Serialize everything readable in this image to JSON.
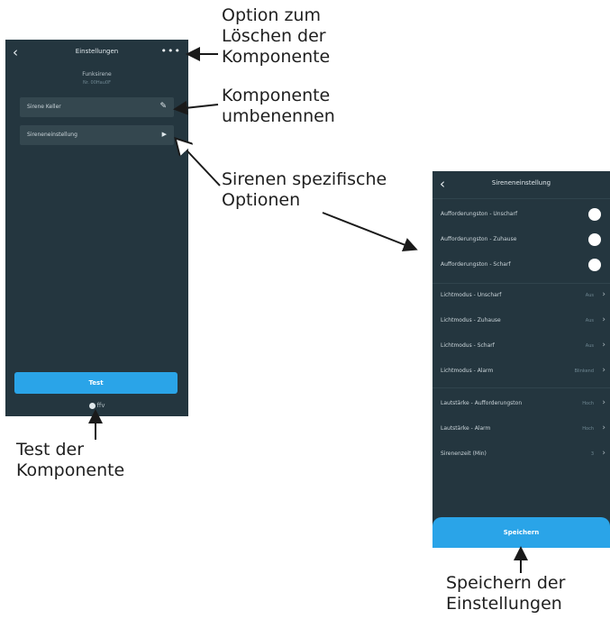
{
  "screen1": {
    "title": "Einstellungen",
    "device_type": "Funksirene",
    "device_status": "Nr. 00Hau0F",
    "rows": [
      {
        "label": "Sirene Keller",
        "icon": "edit-icon"
      },
      {
        "label": "Sireneneinstellung",
        "icon": "chevron-right-icon"
      }
    ],
    "test_button": "Test",
    "footer_label": "ffv"
  },
  "screen2": {
    "title": "Sireneneinstellung",
    "toggles": [
      {
        "label": "Aufforderungston - Unscharf",
        "on": true
      },
      {
        "label": "Aufforderungston - Zuhause",
        "on": true
      },
      {
        "label": "Aufforderungston - Scharf",
        "on": true
      }
    ],
    "light_modes": [
      {
        "label": "Lichtmodus - Unscharf",
        "value": "Aus"
      },
      {
        "label": "Lichtmodus - Zuhause",
        "value": "Aus"
      },
      {
        "label": "Lichtmodus - Scharf",
        "value": "Aus"
      },
      {
        "label": "Lichtmodus - Alarm",
        "value": "Blinkend"
      }
    ],
    "volumes": [
      {
        "label": "Lautstärke - Aufforderungston",
        "value": "Hoch"
      },
      {
        "label": "Lautstärke - Alarm",
        "value": "Hoch"
      },
      {
        "label": "Sirenenzeit (Min)",
        "value": "3"
      }
    ],
    "save_button": "Speichern"
  },
  "annotations": {
    "delete": [
      "Option zum",
      "Löschen der",
      "Komponente"
    ],
    "rename": [
      "Komponente",
      "umbenennen"
    ],
    "siren": [
      "Sirenen spezifische",
      "Optionen"
    ],
    "test": [
      "Test der",
      "Komponente"
    ],
    "save": [
      "Speichern der",
      "Einstellungen"
    ]
  }
}
